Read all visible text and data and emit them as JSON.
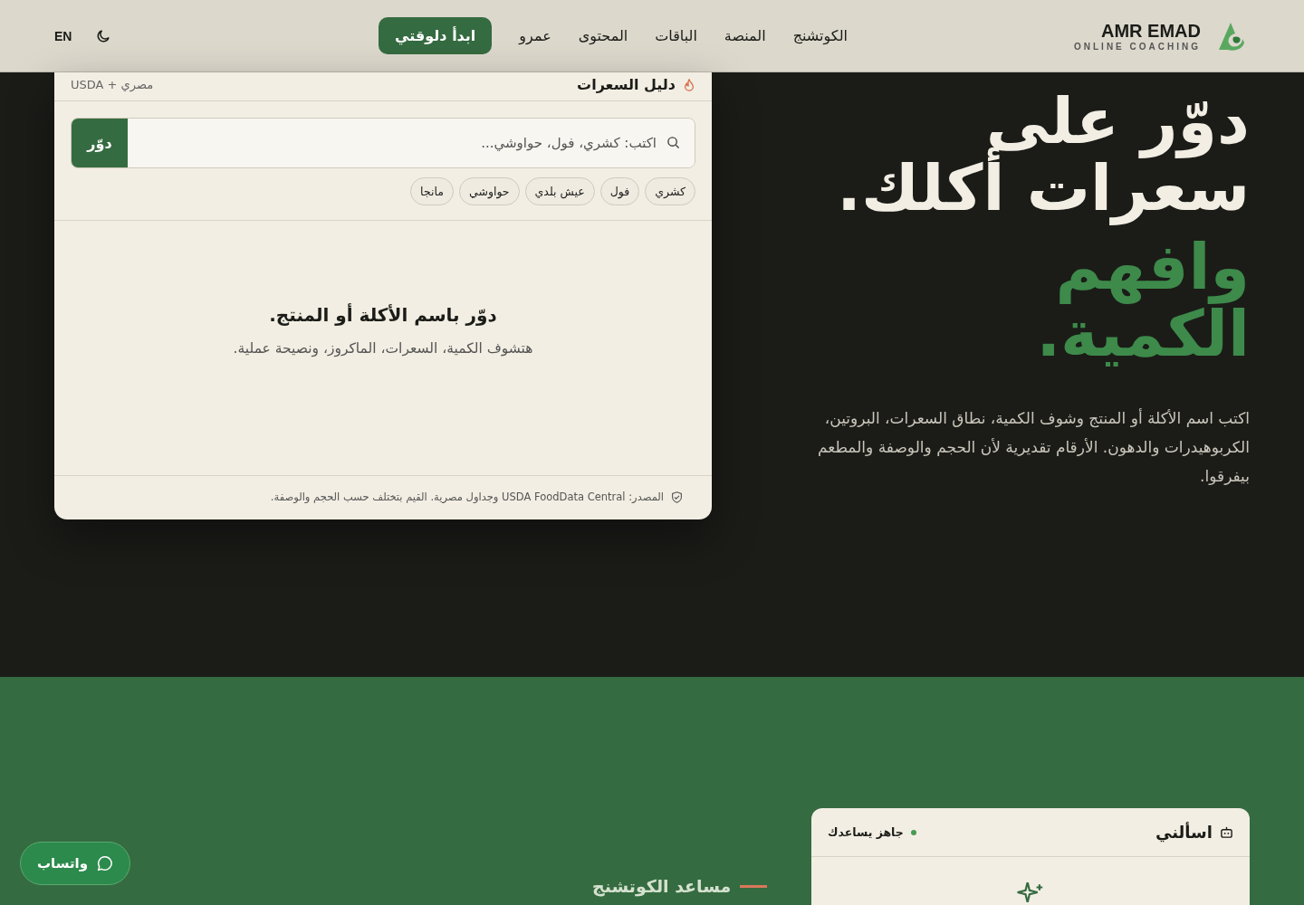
{
  "header": {
    "brand": {
      "name": "AMR EMAD",
      "tagline": "ONLINE COACHING"
    },
    "nav": [
      {
        "label": "الكوتشنج"
      },
      {
        "label": "المنصة"
      },
      {
        "label": "الباقات"
      },
      {
        "label": "المحتوى"
      },
      {
        "label": "عمرو"
      }
    ],
    "cta": "ابدأ دلوقتي",
    "language": "EN"
  },
  "calorie_card": {
    "title": "دليل السعرات",
    "source_badge": "مصري + USDA",
    "search": {
      "placeholder": "اكتب: كشري، فول، حواوشي...",
      "button": "دوّر"
    },
    "suggestions": [
      "كشري",
      "فول",
      "عيش بلدي",
      "حواوشي",
      "مانجا"
    ],
    "empty_title": "دوّر باسم الأكلة أو المنتج.",
    "empty_text": "هتشوف الكمية، السعرات، الماكروز، ونصيحة عملية.",
    "footnote": "المصدر: USDA FoodData Central وجداول مصرية. القيم بتختلف حسب الحجم والوصفة."
  },
  "hero": {
    "title_lines": [
      "دوّر على",
      "سعرات أكلك."
    ],
    "accent_lines": [
      "وافهم",
      "الكمية."
    ],
    "description": "اكتب اسم الأكلة أو المنتج وشوف الكمية، نطاق السعرات، البروتين، الكربوهيدرات والدهون. الأرقام تقديرية لأن الحجم والوصفة والمطعم بيفرقوا."
  },
  "assistant": {
    "section_label": "مساعد الكوتشنج",
    "chat": {
      "title": "اسألني",
      "status": "جاهز يساعدك",
      "online": true
    }
  },
  "whatsapp": "واتساب"
}
